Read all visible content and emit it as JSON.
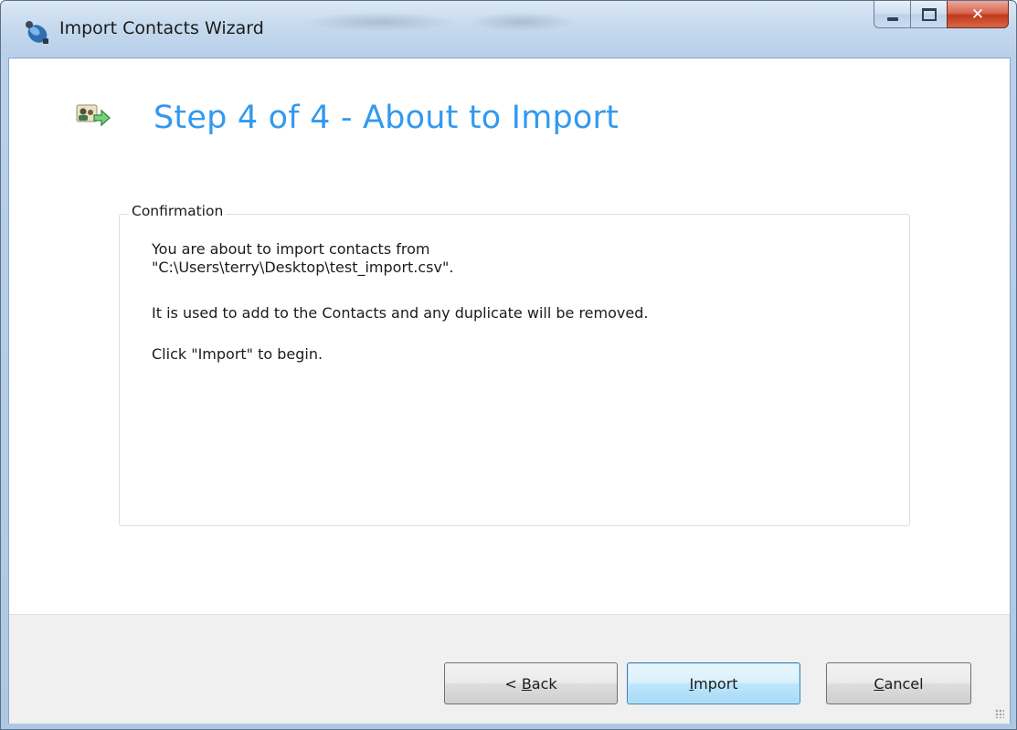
{
  "window": {
    "title": "Import Contacts Wizard"
  },
  "header": {
    "title": "Step 4 of 4 - About to Import",
    "icon": "import-contacts-icon",
    "title_color": "#3399ee"
  },
  "confirmation": {
    "legend": "Confirmation",
    "line1": "You are about to import contacts from",
    "line2": "\"C:\\Users\\terry\\Desktop\\test_import.csv\".",
    "line3": "It is used to add to the Contacts and any duplicate will be removed.",
    "line4": "Click \"Import\" to begin."
  },
  "buttons": {
    "back_prefix": "< ",
    "back_mnemonic": "B",
    "back_rest": "ack",
    "import_mnemonic": "I",
    "import_rest": "mport",
    "cancel_mnemonic": "C",
    "cancel_rest": "ancel"
  }
}
